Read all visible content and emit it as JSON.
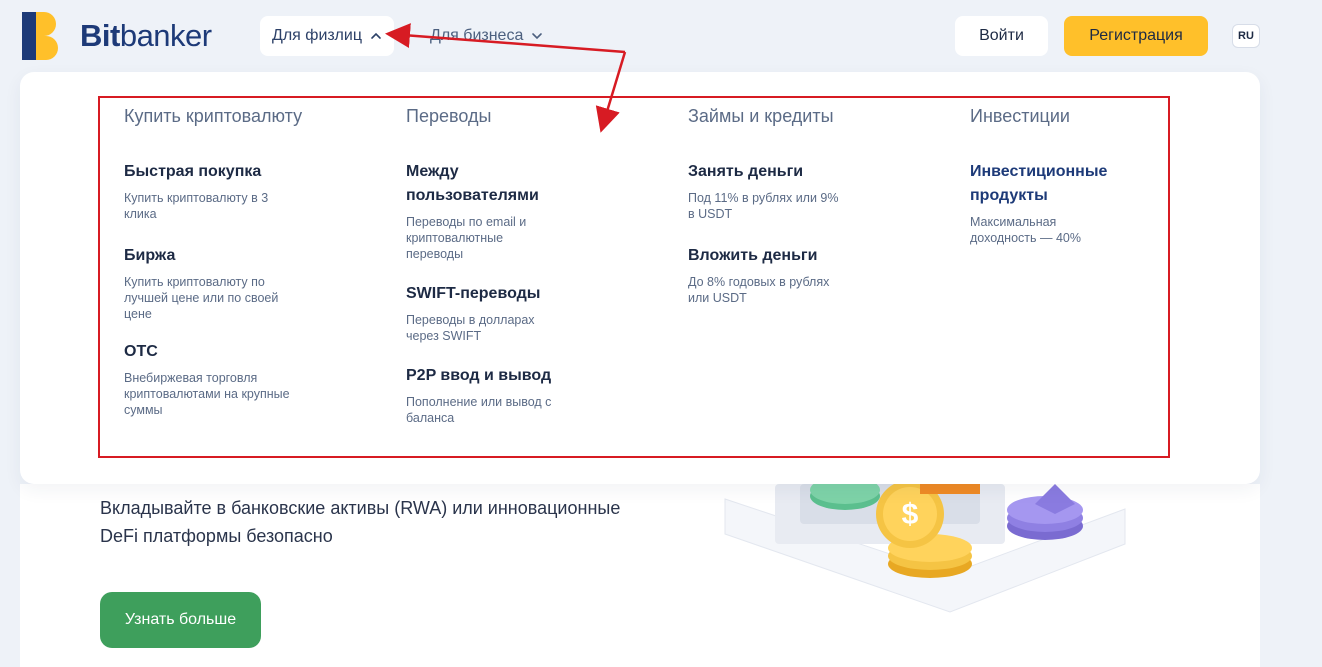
{
  "header": {
    "brand": {
      "bold": "Bit",
      "regular": "banker"
    },
    "nav": [
      {
        "label": "Для физлиц",
        "icon": "chevron-up-icon"
      },
      {
        "label": "Для бизнеса",
        "icon": "chevron-down-icon"
      }
    ],
    "login_label": "Войти",
    "register_label": "Регистрация",
    "lang_label": "RU"
  },
  "menu": {
    "columns": [
      {
        "title": "Купить криптовалюту",
        "items": [
          {
            "title": "Быстрая покупка",
            "desc": "Купить криптовалюту в 3 клика"
          },
          {
            "title": "Биржа",
            "desc": "Купить криптовалюту по лучшей цене или по своей цене"
          },
          {
            "title": "OTC",
            "desc": "Внебиржевая торговля криптовалютами на крупные суммы"
          }
        ]
      },
      {
        "title": "Переводы",
        "items": [
          {
            "title": "Между пользователями",
            "desc": "Переводы по email и криптовалютные переводы"
          },
          {
            "title": "SWIFT-переводы",
            "desc": "Переводы в долларах через SWIFT"
          },
          {
            "title": "P2P ввод и вывод",
            "desc": "Пополнение или вывод с баланса"
          }
        ]
      },
      {
        "title": "Займы и кредиты",
        "items": [
          {
            "title": "Занять деньги",
            "desc": "Под 11% в рублях или 9% в USDT"
          },
          {
            "title": "Вложить деньги",
            "desc": "До 8% годовых в рублях или USDT"
          }
        ]
      },
      {
        "title": "Инвестиции",
        "items": [
          {
            "title": "Инвестиционные продукты",
            "desc": "Максимальная доходность — 40%"
          }
        ]
      }
    ]
  },
  "hero": {
    "text": "Вкладывайте в банковские активы (RWA) или инновационные DeFi платформы безопасно",
    "button_label": "Узнать больше"
  },
  "colors": {
    "accent_yellow": "#ffc02a",
    "brand_blue": "#1d3a78",
    "cta_green": "#3e9f5c",
    "annotation_red": "#d71b23"
  }
}
